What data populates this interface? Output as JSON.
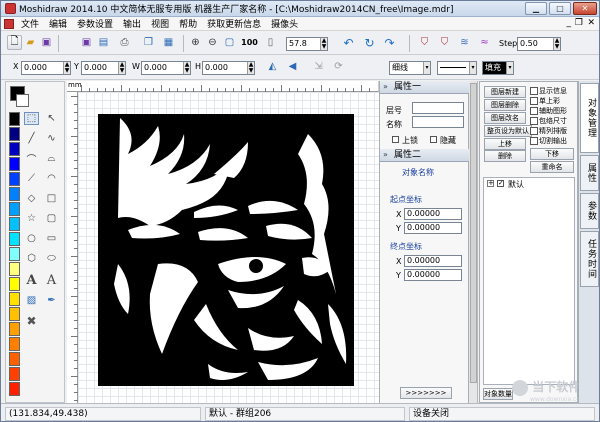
{
  "window": {
    "title": "Moshidraw 2014.10 中文简体无服专用版 机器生产厂家名称 - [C:\\Moshidraw2014CN_free\\Image.mdr]"
  },
  "menu": [
    "文件",
    "编辑",
    "参数设置",
    "输出",
    "视图",
    "帮助",
    "获取更新信息",
    "摄像头"
  ],
  "toolbar": {
    "zoom_value": "57.8",
    "step_label": "Step",
    "step_value": "0.50"
  },
  "coords": {
    "x_label": "X",
    "x_value": "0.000",
    "y_label": "Y",
    "y_value": "0.000",
    "w_label": "W",
    "w_value": "0.000",
    "h_label": "H",
    "h_value": "0.000",
    "line_style": "细线",
    "fill_label": "填充"
  },
  "ruler": {
    "unit": "mm"
  },
  "palette": {
    "colors": [
      "#000000",
      "#000080",
      "#0000c0",
      "#0000ff",
      "#0040ff",
      "#0080ff",
      "#00a0ff",
      "#00c0ff",
      "#00e0ff",
      "#80ffff",
      "#ffff80",
      "#ffff00",
      "#ffe000",
      "#ffc000",
      "#ffa000",
      "#ff8000",
      "#ff6000",
      "#ff4000",
      "#ff2000"
    ],
    "current_fg": "#000000",
    "current_bg": "#ffffff"
  },
  "props": {
    "section1_title": "属性一",
    "layer_label": "层号",
    "name_label": "名称",
    "lock_label": "上锁",
    "hide_label": "隐藏",
    "section2_title": "属性二",
    "object_name": "对象名称",
    "start_label": "起点坐标",
    "end_label": "终点坐标",
    "x_label": "X",
    "y_label": "Y",
    "sx": "0.00000",
    "sy": "0.00000",
    "ex": "0.00000",
    "ey": "0.00000",
    "more_button": ">>>>>>>"
  },
  "layers": {
    "buttons": [
      "图层新建",
      "图层删除",
      "图层改名",
      "整页设为默认",
      "上移",
      "下移",
      "删除",
      "重命名"
    ],
    "checks": [
      "显示信息",
      "单上彩",
      "辅助图形",
      "包络尺寸",
      "精列排版",
      "切割输出"
    ],
    "tree_item": "默认",
    "bottom_button": "对象数量"
  },
  "vtabs": [
    "对象管理",
    "属性",
    "参数",
    "任务时间"
  ],
  "status": {
    "coords": "(131.834,49.438)",
    "selection": "默认 - 群组206",
    "device": "设备关闭"
  },
  "watermark": {
    "text": "当下软件园",
    "sub": "www.downxia.com"
  }
}
